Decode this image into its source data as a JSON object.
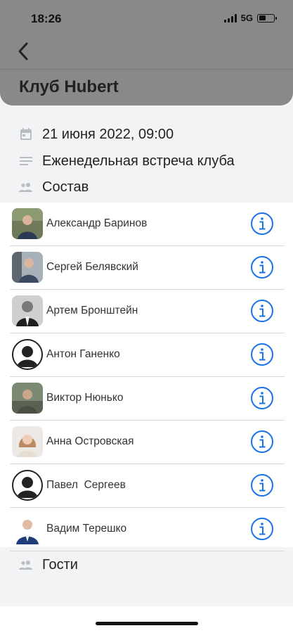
{
  "status_bar": {
    "time": "18:26",
    "network": "5G",
    "battery_level": 0.45
  },
  "header": {
    "title": "Клуб Hubert",
    "back_icon": "chevron-left-icon"
  },
  "event": {
    "datetime": "21 июня 2022, 09:00",
    "description": "Еженедельная встреча клуба",
    "members_label": "Состав",
    "guests_label": "Гости"
  },
  "members": [
    {
      "name": "Александр Баринов",
      "avatar": "photo"
    },
    {
      "name": "Сергей Белявский",
      "avatar": "photo"
    },
    {
      "name": "Артем Бронштейн",
      "avatar": "photo"
    },
    {
      "name": "Антон Ганенко",
      "avatar": "silhouette"
    },
    {
      "name": "Виктор Нюнько",
      "avatar": "photo"
    },
    {
      "name": "Анна Островская",
      "avatar": "photo"
    },
    {
      "name": "Павел  Сергеев",
      "avatar": "silhouette"
    },
    {
      "name": "Вадим Терешко",
      "avatar": "photo"
    }
  ],
  "colors": {
    "accent": "#1a73e8",
    "header_bg": "#898989",
    "page_bg": "#f2f3f5",
    "icon_gray": "#b9bcc2"
  }
}
